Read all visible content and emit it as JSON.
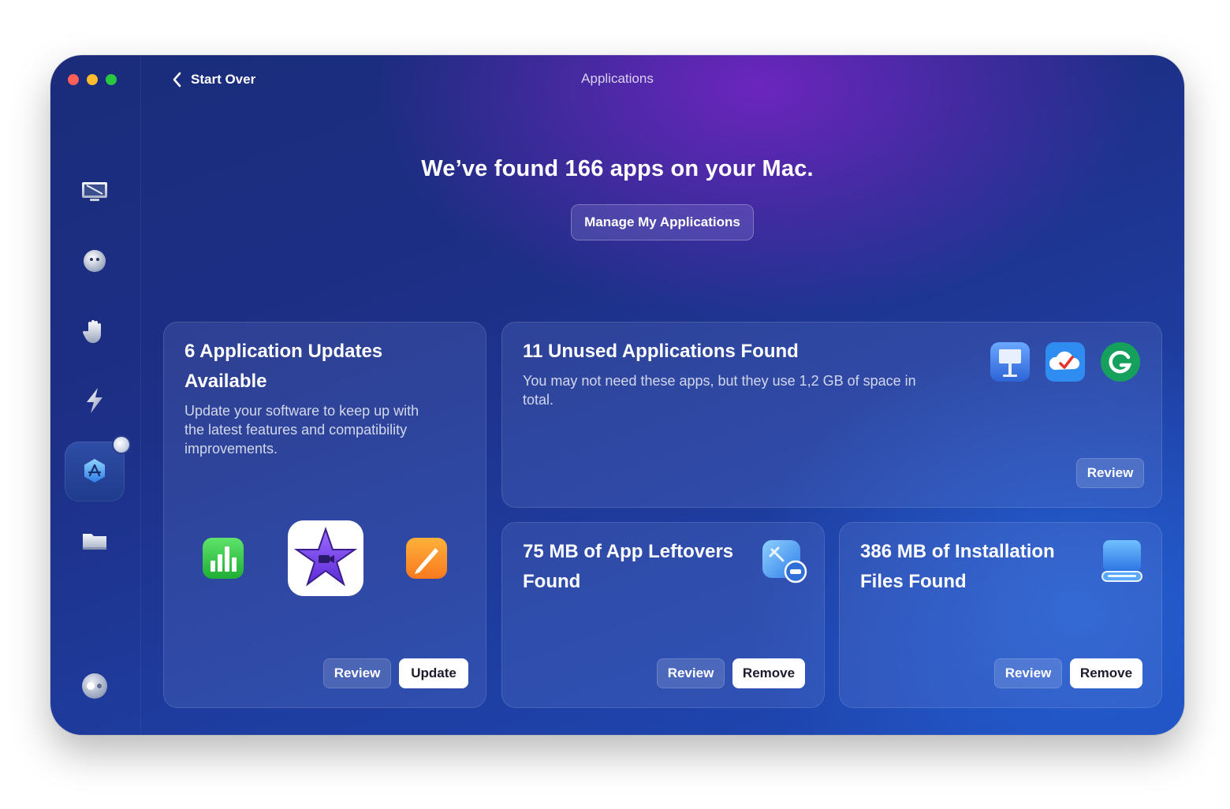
{
  "window": {
    "title": "Applications",
    "back_label": "Start Over"
  },
  "sidebar": {
    "items": [
      {
        "name": "sidebar-item-cleanup",
        "icon": "monitor-broom-icon"
      },
      {
        "name": "sidebar-item-protection",
        "icon": "shield-ball-icon"
      },
      {
        "name": "sidebar-item-privacy",
        "icon": "hand-icon"
      },
      {
        "name": "sidebar-item-speed",
        "icon": "lightning-icon"
      },
      {
        "name": "sidebar-item-applications",
        "icon": "app-store-icon",
        "active": true
      },
      {
        "name": "sidebar-item-files",
        "icon": "folder-icon"
      },
      {
        "name": "sidebar-item-assistant",
        "icon": "toggle-icon"
      }
    ]
  },
  "main": {
    "headline": "We’ve found 166 apps on your Mac.",
    "manage_label": "Manage My Applications",
    "cards": {
      "updates": {
        "title_line1": "6 Application Updates",
        "title_line2": "Available",
        "desc_line1": "Update your software to keep up with",
        "desc_line2": "the latest features and compatibility",
        "desc_line3": "improvements.",
        "icons": [
          "numbers-app-icon",
          "imovie-app-icon",
          "pages-app-icon"
        ],
        "review_label": "Review",
        "action_label": "Update"
      },
      "unused": {
        "title": "11 Unused Applications Found",
        "desc_line1": "You may not need these apps, but they use 1,2 GB of space in",
        "desc_line2": "total.",
        "icons": [
          "keynote-app-icon",
          "cloud-app-icon",
          "grammarly-app-icon"
        ],
        "review_label": "Review"
      },
      "leftovers": {
        "title_line1": "75 MB of App Leftovers",
        "title_line2": "Found",
        "icon": "app-leftovers-icon",
        "review_label": "Review",
        "action_label": "Remove"
      },
      "installation": {
        "title_line1": "386 MB of Installation",
        "title_line2": "Files Found",
        "icon": "installation-drive-icon",
        "review_label": "Review",
        "action_label": "Remove"
      }
    }
  }
}
